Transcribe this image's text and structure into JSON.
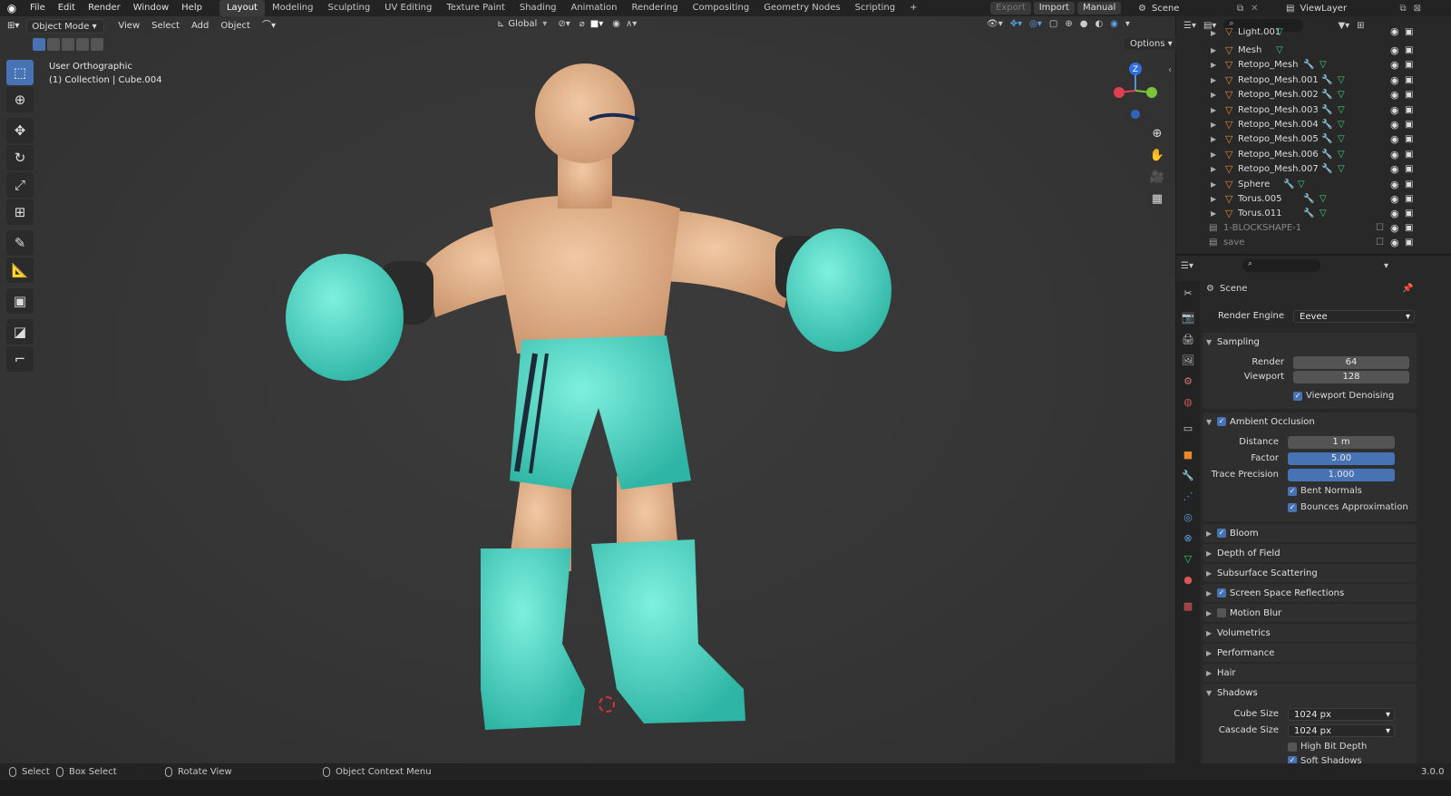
{
  "topbar": {
    "menus": [
      "File",
      "Edit",
      "Render",
      "Window",
      "Help"
    ],
    "workspaces": [
      "Layout",
      "Modeling",
      "Sculpting",
      "UV Editing",
      "Texture Paint",
      "Shading",
      "Animation",
      "Rendering",
      "Compositing",
      "Geometry Nodes",
      "Scripting"
    ],
    "active_workspace": "Layout",
    "add_tab": "+",
    "export_label": "Export",
    "import_label": "Import",
    "manual_label": "Manual",
    "scene_name": "Scene",
    "view_layer": "ViewLayer"
  },
  "viewport_header": {
    "mode": "Object Mode",
    "menus": [
      "View",
      "Select",
      "Add",
      "Object"
    ],
    "orientation": "Global",
    "options_label": "Options"
  },
  "viewport": {
    "view_name": "User Orthographic",
    "collection_info": "(1) Collection | Cube.004",
    "gizmo_axis": "Z",
    "accent": "#4772b3"
  },
  "outliner": {
    "items": [
      {
        "name": "Light.001",
        "modifier": false
      },
      {
        "name": "Mesh",
        "modifier": false
      },
      {
        "name": "Retopo_Mesh",
        "modifier": true
      },
      {
        "name": "Retopo_Mesh.001",
        "modifier": true
      },
      {
        "name": "Retopo_Mesh.002",
        "modifier": true
      },
      {
        "name": "Retopo_Mesh.003",
        "modifier": true
      },
      {
        "name": "Retopo_Mesh.004",
        "modifier": true
      },
      {
        "name": "Retopo_Mesh.005",
        "modifier": true
      },
      {
        "name": "Retopo_Mesh.006",
        "modifier": true
      },
      {
        "name": "Retopo_Mesh.007",
        "modifier": true
      },
      {
        "name": "Sphere",
        "modifier": true
      },
      {
        "name": "Torus.005",
        "modifier": true
      },
      {
        "name": "Torus.011",
        "modifier": true
      }
    ],
    "collections": [
      "1-BLOCKSHAPE-1",
      "save"
    ]
  },
  "properties": {
    "context": "Scene",
    "render_engine_label": "Render Engine",
    "render_engine": "Eevee",
    "sampling": {
      "title": "Sampling",
      "render_label": "Render",
      "render": "64",
      "viewport_label": "Viewport",
      "viewport": "128",
      "denoise_label": "Viewport Denoising"
    },
    "ao": {
      "title": "Ambient Occlusion",
      "distance_label": "Distance",
      "distance": "1 m",
      "factor_label": "Factor",
      "factor": "5.00",
      "trace_label": "Trace Precision",
      "trace": "1.000",
      "bent_label": "Bent Normals",
      "bounce_label": "Bounces Approximation"
    },
    "panels": {
      "bloom": "Bloom",
      "dof": "Depth of Field",
      "sss": "Subsurface Scattering",
      "ssr": "Screen Space Reflections",
      "motion": "Motion Blur",
      "volumetrics": "Volumetrics",
      "performance": "Performance",
      "hair": "Hair",
      "shadows": "Shadows"
    },
    "shadows": {
      "cube_label": "Cube Size",
      "cube": "1024 px",
      "cascade_label": "Cascade Size",
      "cascade": "1024 px",
      "hbd_label": "High Bit Depth",
      "soft_label": "Soft Shadows"
    }
  },
  "status": {
    "select": "Select",
    "box_select": "Box Select",
    "rotate": "Rotate View",
    "context_menu": "Object Context Menu",
    "version": "3.0.0"
  }
}
